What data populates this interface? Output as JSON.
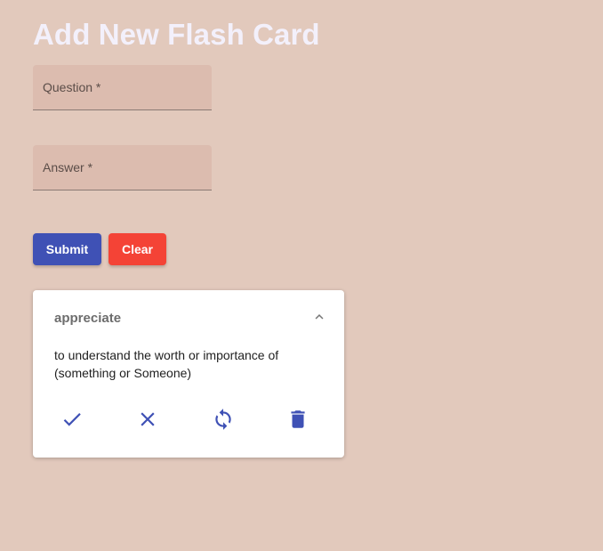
{
  "page": {
    "title": "Add New Flash Card"
  },
  "form": {
    "question_label": "Question *",
    "answer_label": "Answer *",
    "submit_label": "Submit",
    "clear_label": "Clear"
  },
  "card": {
    "term": "appreciate",
    "definition": "to understand the worth or importance of (something or Someone)",
    "actions": [
      {
        "icon": "check-icon"
      },
      {
        "icon": "close-icon"
      },
      {
        "icon": "refresh-icon"
      },
      {
        "icon": "delete-icon"
      }
    ]
  },
  "colors": {
    "background": "#e2c9bc",
    "primary": "#3f51b5",
    "danger": "#f44336",
    "title": "#f3f0fb"
  }
}
